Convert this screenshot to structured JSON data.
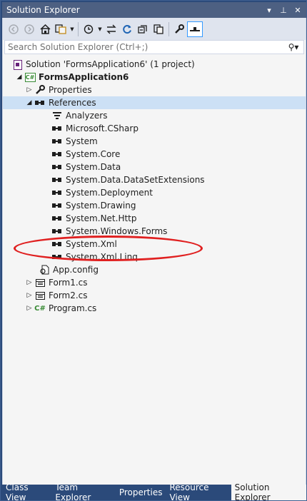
{
  "window": {
    "title": "Solution Explorer",
    "pin_glyph": "⊥",
    "menu_glyph": "▾",
    "close_glyph": "✕"
  },
  "toolbar": {
    "icons": [
      "back-icon",
      "forward-icon",
      "home-icon",
      "switch-views-icon",
      "pending-changes-icon",
      "sync-icon",
      "refresh-icon",
      "collapse-all-icon",
      "show-all-files-icon",
      "properties-icon",
      "preview-icon"
    ]
  },
  "search": {
    "placeholder": "Search Solution Explorer (Ctrl+;)"
  },
  "tree": {
    "solution": "Solution 'FormsApplication6' (1 project)",
    "project": "FormsApplication6",
    "properties": "Properties",
    "references": "References",
    "refs": [
      "Analyzers",
      "Microsoft.CSharp",
      "System",
      "System.Core",
      "System.Data",
      "System.Data.DataSetExtensions",
      "System.Deployment",
      "System.Drawing",
      "System.Net.Http",
      "System.Windows.Forms",
      "System.Xml",
      "System.Xml.Linq"
    ],
    "app_config": "App.config",
    "form1": "Form1.cs",
    "form2": "Form2.cs",
    "program": "Program.cs",
    "project_icon_text": "C#",
    "cs_icon_text": "C#"
  },
  "tabs": [
    "Class View",
    "Team Explorer",
    "Properties",
    "Resource View",
    "Solution Explorer"
  ],
  "colors": {
    "frame": "#2b4a7a",
    "titlebar": "#4d6082",
    "selected_row": "#cce0f5",
    "highlight": "#e02020"
  }
}
